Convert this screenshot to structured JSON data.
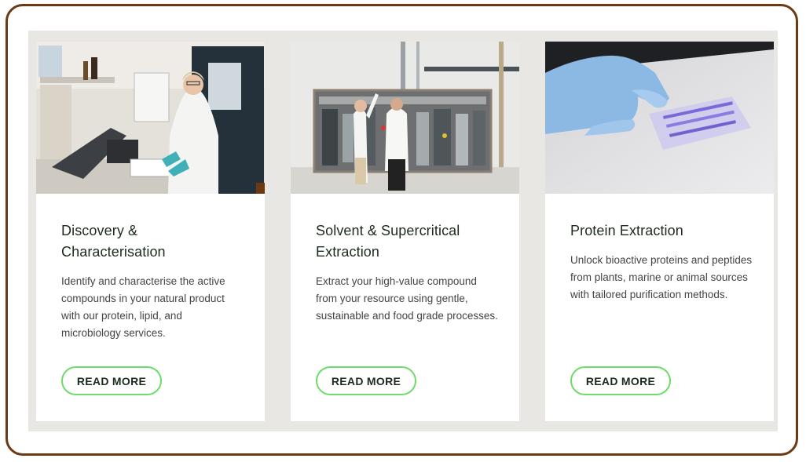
{
  "cards": [
    {
      "image_alt": "lab-scientist-photo",
      "title": "Discovery & Characterisation",
      "description": "Identify and characterise the active compounds in your natural product with our protein, lipid, and microbiology services.",
      "button_label": "READ MORE"
    },
    {
      "image_alt": "extraction-plant-photo",
      "title": "Solvent & Supercritical Extraction",
      "description": "Extract your high-value compound from your resource using gentle, sustainable and food grade processes.",
      "button_label": "READ MORE"
    },
    {
      "image_alt": "protein-gel-photo",
      "title": "Protein Extraction",
      "description": "Unlock bioactive proteins and peptides from plants, marine or animal sources with tailored purification methods.",
      "button_label": "READ MORE"
    }
  ],
  "colors": {
    "frame_border": "#6b3a14",
    "panel_bg": "#e9e7e4",
    "button_border": "#6fdc6a",
    "title_text": "#1d2b1d"
  }
}
